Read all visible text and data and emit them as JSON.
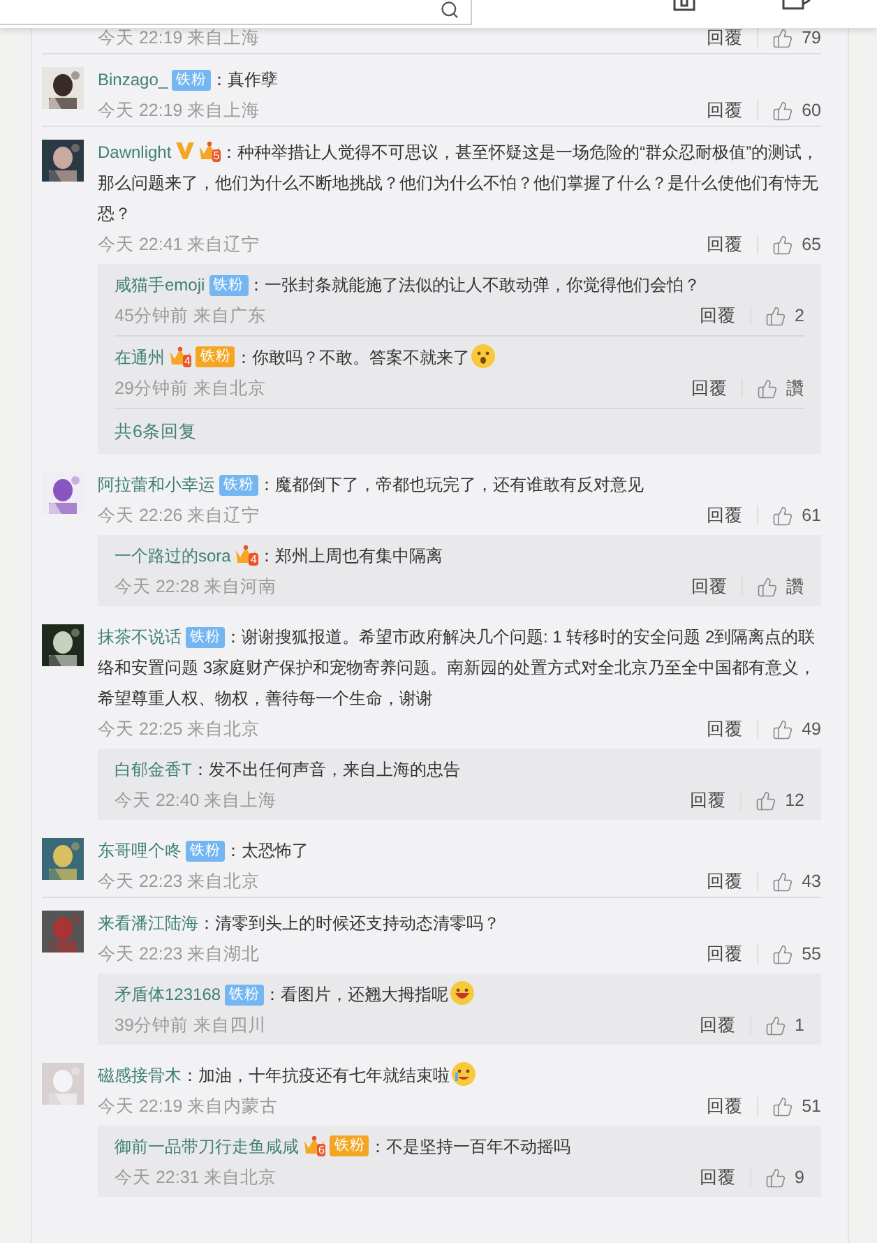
{
  "comments": [
    {
      "meta": "今天 22:19 来自上海",
      "reply": "回覆",
      "likes": "79"
    },
    {
      "name": "Binzago_",
      "badges": [
        {
          "kind": "fan",
          "label": "铁粉"
        }
      ],
      "text": "：真作孽",
      "meta": "今天 22:19 来自上海",
      "reply": "回覆",
      "likes": "60"
    },
    {
      "name": "Dawnlight",
      "badges": [
        {
          "kind": "verified"
        },
        {
          "kind": "crown",
          "level": "5"
        }
      ],
      "text": "：种种举措让人觉得不可思议，甚至怀疑这是一场危险的“群众忍耐极值”的测试，那么问题来了，他们为什么不断地挑战？他们为什么不怕？他们掌握了什么？是什么使他们有恃无恐？",
      "meta": "今天 22:41 来自辽宁",
      "reply": "回覆",
      "likes": "65",
      "replies": [
        {
          "name": "咸猫手emoji",
          "badges": [
            {
              "kind": "fan",
              "label": "铁粉"
            }
          ],
          "text": "：一张封条就能施了法似的让人不敢动弹，你觉得他们会怕？",
          "meta": "45分钟前 来自广东",
          "reply": "回覆",
          "likes": "2"
        },
        {
          "name": "在通州",
          "badges": [
            {
              "kind": "crown_fan",
              "level": "4",
              "label": "铁粉"
            }
          ],
          "text": "：你敢吗？不敢。答案不就来了",
          "emoji": {
            "kind": "shocked"
          },
          "meta": "29分钟前 来自北京",
          "reply": "回覆",
          "likes": "讚"
        }
      ],
      "more": "共6条回复"
    },
    {
      "name": "阿拉蕾和小幸运",
      "badges": [
        {
          "kind": "fan",
          "label": "铁粉"
        }
      ],
      "text": "：魔都倒下了，帝都也玩完了，还有谁敢有反对意见",
      "meta": "今天 22:26 来自辽宁",
      "reply": "回覆",
      "likes": "61",
      "replies": [
        {
          "name": "一个路过的sora",
          "badges": [
            {
              "kind": "crown",
              "level": "4"
            }
          ],
          "text": "：郑州上周也有集中隔离",
          "meta": "今天 22:28 来自河南",
          "reply": "回覆",
          "likes": "讚"
        }
      ]
    },
    {
      "name": "抹茶不说话",
      "badges": [
        {
          "kind": "fan",
          "label": "铁粉"
        }
      ],
      "text": "：谢谢搜狐报道。希望市政府解决几个问题: 1 转移时的安全问题 2到隔离点的联络和安置问题 3家庭财产保护和宠物寄养问题。南新园的处置方式对全北京乃至全中国都有意义，希望尊重人权、物权，善待每一个生命，谢谢",
      "meta": "今天 22:25 来自北京",
      "reply": "回覆",
      "likes": "49",
      "replies": [
        {
          "name": "白郁金香T",
          "text": "：发不出任何声音，来自上海的忠告",
          "meta": "今天 22:40 来自上海",
          "reply": "回覆",
          "likes": "12"
        }
      ]
    },
    {
      "name": "东哥哩个咚",
      "badges": [
        {
          "kind": "fan",
          "label": "铁粉"
        }
      ],
      "text": "：太恐怖了",
      "meta": "今天 22:23 来自北京",
      "reply": "回覆",
      "likes": "43"
    },
    {
      "name": "来看潘江陆海",
      "text": "：清零到头上的时候还支持动态清零吗？",
      "meta": "今天 22:23 来自湖北",
      "reply": "回覆",
      "likes": "55",
      "replies": [
        {
          "name": "矛盾体123168",
          "badges": [
            {
              "kind": "fan",
              "label": "铁粉"
            }
          ],
          "text": "：看图片，还翘大拇指呢",
          "emoji": {
            "kind": "laugh"
          },
          "meta": "39分钟前 来自四川",
          "reply": "回覆",
          "likes": "1"
        }
      ]
    },
    {
      "name": "磁感接骨木",
      "text": "：加油，十年抗疫还有七年就结束啦",
      "emoji": {
        "kind": "cry"
      },
      "meta": "今天 22:19 来自内蒙古",
      "reply": "回覆",
      "likes": "51",
      "replies": [
        {
          "name": "御前一品带刀行走鱼咸咸",
          "badges": [
            {
              "kind": "crown_fan",
              "level": "6",
              "label": "铁粉"
            }
          ],
          "text": "：不是坚持一百年不动摇吗",
          "meta": "今天 22:31 来自北京",
          "reply": "回覆",
          "likes": "9"
        }
      ]
    }
  ]
}
